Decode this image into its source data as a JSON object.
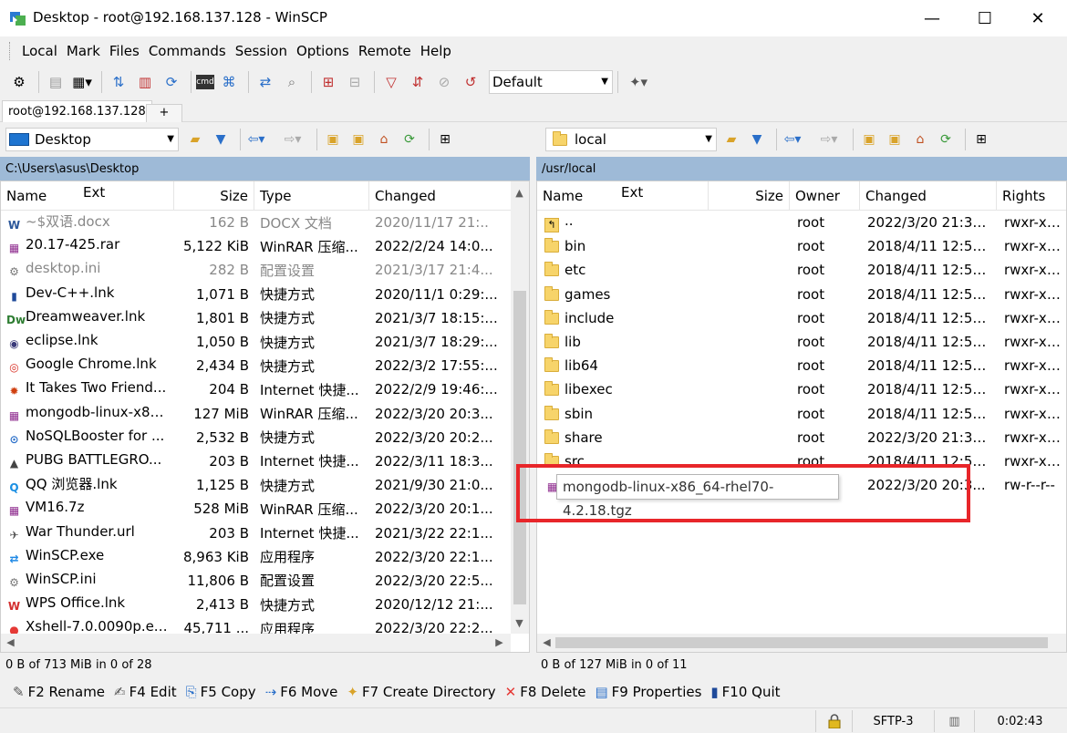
{
  "window": {
    "title": "Desktop - root@192.168.137.128 - WinSCP",
    "minimize": "—",
    "maximize": "☐",
    "close": "✕"
  },
  "menu": [
    "Local",
    "Mark",
    "Files",
    "Commands",
    "Session",
    "Options",
    "Remote",
    "Help"
  ],
  "toolbar": {
    "transfer_profile": "Default"
  },
  "session_tab": {
    "label": "root@192.168.137.128",
    "new_tab": "+"
  },
  "left": {
    "location": "Desktop",
    "path": "C:\\Users\\asus\\Desktop",
    "columns": [
      "Name",
      "Ext",
      "Size",
      "Type",
      "Changed"
    ],
    "files": [
      {
        "name": "~$双语.docx",
        "size": "162 B",
        "type": "DOCX 文档",
        "changed": "2020/11/17  21:..",
        "icon": "word-doc-icon",
        "dim": true
      },
      {
        "name": "20.17-425.rar",
        "size": "5,122 KiB",
        "type": "WinRAR 压缩...",
        "changed": "2022/2/24  14:0...",
        "icon": "winrar-archive-icon",
        "dim": false
      },
      {
        "name": "desktop.ini",
        "size": "282 B",
        "type": "配置设置",
        "changed": "2021/3/17  21:4...",
        "icon": "ini-file-icon",
        "dim": true
      },
      {
        "name": "Dev-C++.lnk",
        "size": "1,071 B",
        "type": "快捷方式",
        "changed": "2020/11/1  0:29:...",
        "icon": "devcpp-icon",
        "dim": false
      },
      {
        "name": "Dreamweaver.lnk",
        "size": "1,801 B",
        "type": "快捷方式",
        "changed": "2021/3/7  18:15:...",
        "icon": "dreamweaver-icon",
        "dim": false
      },
      {
        "name": "eclipse.lnk",
        "size": "1,050 B",
        "type": "快捷方式",
        "changed": "2021/3/7  18:29:...",
        "icon": "eclipse-icon",
        "dim": false
      },
      {
        "name": "Google Chrome.lnk",
        "size": "2,434 B",
        "type": "快捷方式",
        "changed": "2022/3/2  17:55:...",
        "icon": "chrome-icon",
        "dim": false
      },
      {
        "name": "It Takes Two Friend...",
        "size": "204 B",
        "type": "Internet 快捷...",
        "changed": "2022/2/9  19:46:...",
        "icon": "game-icon",
        "dim": false
      },
      {
        "name": "mongodb-linux-x86...",
        "size": "127 MiB",
        "type": "WinRAR 压缩...",
        "changed": "2022/3/20  20:3...",
        "icon": "winrar-archive-icon",
        "dim": false
      },
      {
        "name": "NoSQLBooster for ...",
        "size": "2,532 B",
        "type": "快捷方式",
        "changed": "2022/3/20  20:2...",
        "icon": "nosqlbooster-icon",
        "dim": false
      },
      {
        "name": "PUBG BATTLEGRO...",
        "size": "203 B",
        "type": "Internet 快捷...",
        "changed": "2022/3/11  18:3...",
        "icon": "pubg-icon",
        "dim": false
      },
      {
        "name": "QQ 浏览器.lnk",
        "size": "1,125 B",
        "type": "快捷方式",
        "changed": "2021/9/30  21:0...",
        "icon": "qq-browser-icon",
        "dim": false
      },
      {
        "name": "VM16.7z",
        "size": "528 MiB",
        "type": "WinRAR 压缩...",
        "changed": "2022/3/20  20:1...",
        "icon": "winrar-archive-icon",
        "dim": false
      },
      {
        "name": "War Thunder.url",
        "size": "203 B",
        "type": "Internet 快捷...",
        "changed": "2021/3/22  22:1...",
        "icon": "war-thunder-icon",
        "dim": false
      },
      {
        "name": "WinSCP.exe",
        "size": "8,963 KiB",
        "type": "应用程序",
        "changed": "2022/3/20  22:1...",
        "icon": "winscp-icon",
        "dim": false
      },
      {
        "name": "WinSCP.ini",
        "size": "11,806 B",
        "type": "配置设置",
        "changed": "2022/3/20  22:5...",
        "icon": "ini-file-icon",
        "dim": false
      },
      {
        "name": "WPS Office.lnk",
        "size": "2,413 B",
        "type": "快捷方式",
        "changed": "2020/12/12  21:...",
        "icon": "wps-icon",
        "dim": false
      },
      {
        "name": "Xshell-7.0.0090p.exe",
        "size": "45,711 ...",
        "type": "应用程序",
        "changed": "2022/3/20  22:2...",
        "icon": "xshell-icon",
        "dim": false
      }
    ],
    "status": "0 B of 713 MiB in 0 of 28"
  },
  "right": {
    "location": "local",
    "path": "/usr/local",
    "columns": [
      "Name",
      "Ext",
      "Size",
      "Owner",
      "Changed",
      "Rights"
    ],
    "files": [
      {
        "name": "..",
        "owner": "root",
        "changed": "2022/3/20  21:36:...",
        "rights": "rwxr-xr-x",
        "kind": "parent"
      },
      {
        "name": "bin",
        "owner": "root",
        "changed": "2018/4/11  12:59:...",
        "rights": "rwxr-xr-x",
        "kind": "folder"
      },
      {
        "name": "etc",
        "owner": "root",
        "changed": "2018/4/11  12:59:...",
        "rights": "rwxr-xr-x",
        "kind": "folder"
      },
      {
        "name": "games",
        "owner": "root",
        "changed": "2018/4/11  12:59:...",
        "rights": "rwxr-xr-x",
        "kind": "folder"
      },
      {
        "name": "include",
        "owner": "root",
        "changed": "2018/4/11  12:59:...",
        "rights": "rwxr-xr-x",
        "kind": "folder"
      },
      {
        "name": "lib",
        "owner": "root",
        "changed": "2018/4/11  12:59:...",
        "rights": "rwxr-xr-x",
        "kind": "folder"
      },
      {
        "name": "lib64",
        "owner": "root",
        "changed": "2018/4/11  12:59:...",
        "rights": "rwxr-xr-x",
        "kind": "folder"
      },
      {
        "name": "libexec",
        "owner": "root",
        "changed": "2018/4/11  12:59:...",
        "rights": "rwxr-xr-x",
        "kind": "folder"
      },
      {
        "name": "sbin",
        "owner": "root",
        "changed": "2018/4/11  12:59:...",
        "rights": "rwxr-xr-x",
        "kind": "folder"
      },
      {
        "name": "share",
        "owner": "root",
        "changed": "2022/3/20  21:36:...",
        "rights": "rwxr-xr-x",
        "kind": "folder"
      },
      {
        "name": "src",
        "owner": "root",
        "changed": "2018/4/11  12:59:...",
        "rights": "rwxr-xr-x",
        "kind": "folder"
      },
      {
        "name": "mongodb-linux-x86_64-rhel70-4.2.18.tgz",
        "owner": "",
        "changed": "2022/3/20  20:3...",
        "rights": "rw-r--r--",
        "kind": "archive"
      }
    ],
    "tooltip": "mongodb-linux-x86_64-rhel70-4.2.18.tgz",
    "status": "0 B of 127 MiB in 0 of 11"
  },
  "fkeys": [
    {
      "label": "F2 Rename",
      "icon": "rename-icon"
    },
    {
      "label": "F4 Edit",
      "icon": "edit-icon"
    },
    {
      "label": "F5 Copy",
      "icon": "copy-icon"
    },
    {
      "label": "F6 Move",
      "icon": "move-icon"
    },
    {
      "label": "F7 Create Directory",
      "icon": "create-directory-icon"
    },
    {
      "label": "F8 Delete",
      "icon": "delete-icon"
    },
    {
      "label": "F9 Properties",
      "icon": "properties-icon"
    },
    {
      "label": "F10 Quit",
      "icon": "quit-icon"
    }
  ],
  "bottom": {
    "protocol": "SFTP-3",
    "elapsed": "0:02:43"
  },
  "colors": {
    "path_bar": "#9ebad7",
    "highlight": "#e8262a",
    "folder": "#f7d46a"
  }
}
